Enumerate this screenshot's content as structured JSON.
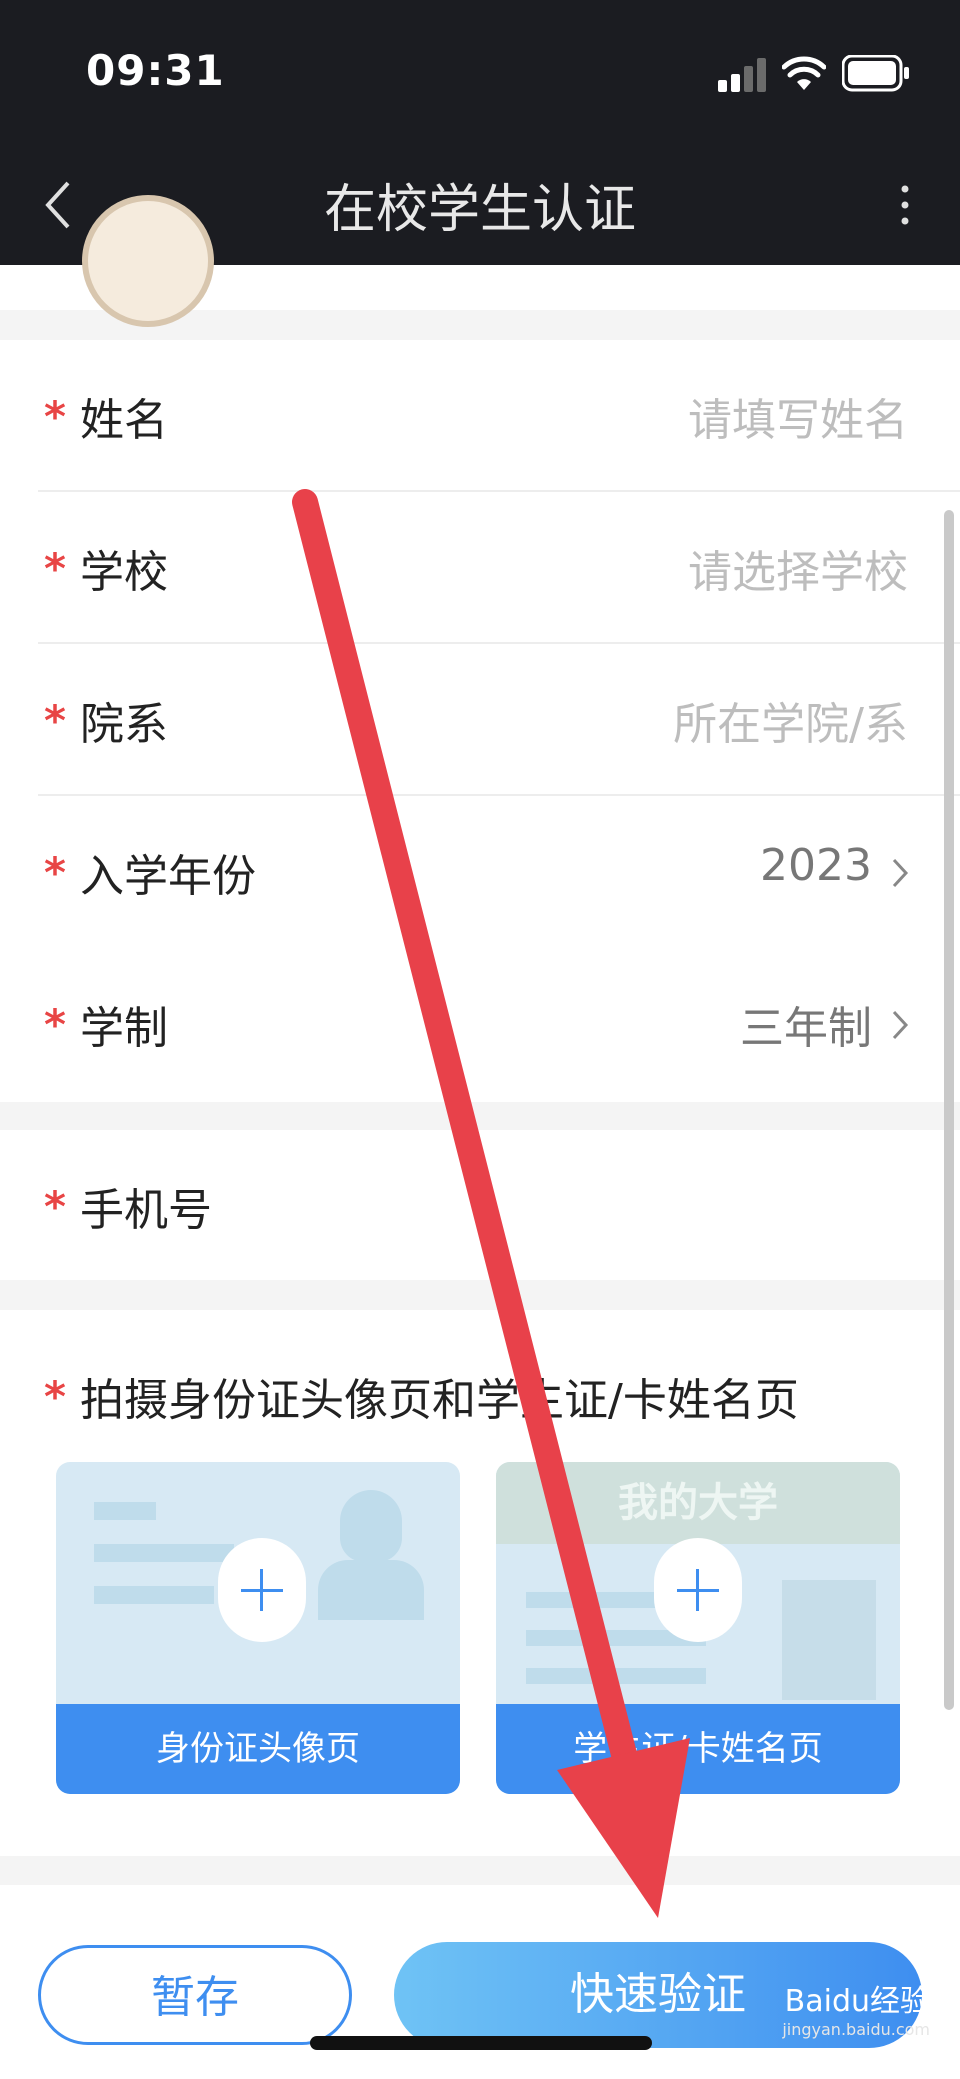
{
  "status_bar": {
    "time": "09:31"
  },
  "nav": {
    "title": "在校学生认证"
  },
  "form": {
    "name": {
      "label": "姓名",
      "placeholder": "请填写姓名"
    },
    "school": {
      "label": "学校",
      "placeholder": "请选择学校"
    },
    "department": {
      "label": "院系",
      "placeholder": "所在学院/系"
    },
    "year": {
      "label": "入学年份",
      "value": "2023"
    },
    "system": {
      "label": "学制",
      "value": "三年制"
    },
    "phone": {
      "label": "手机号"
    },
    "photo": {
      "title": "拍摄身份证头像页和学生证/卡姓名页",
      "id_card_label": "身份证头像页",
      "student_card_label": "学生证/卡姓名页",
      "student_card_header": "我的大学"
    }
  },
  "actions": {
    "save": "暂存",
    "verify": "快速验证"
  },
  "watermark": {
    "brand": "Baidu经验",
    "url": "jingyan.baidu.com"
  },
  "colors": {
    "required_star": "#e84545",
    "primary": "#3e8ef0",
    "annotation_arrow": "#e8414a"
  }
}
